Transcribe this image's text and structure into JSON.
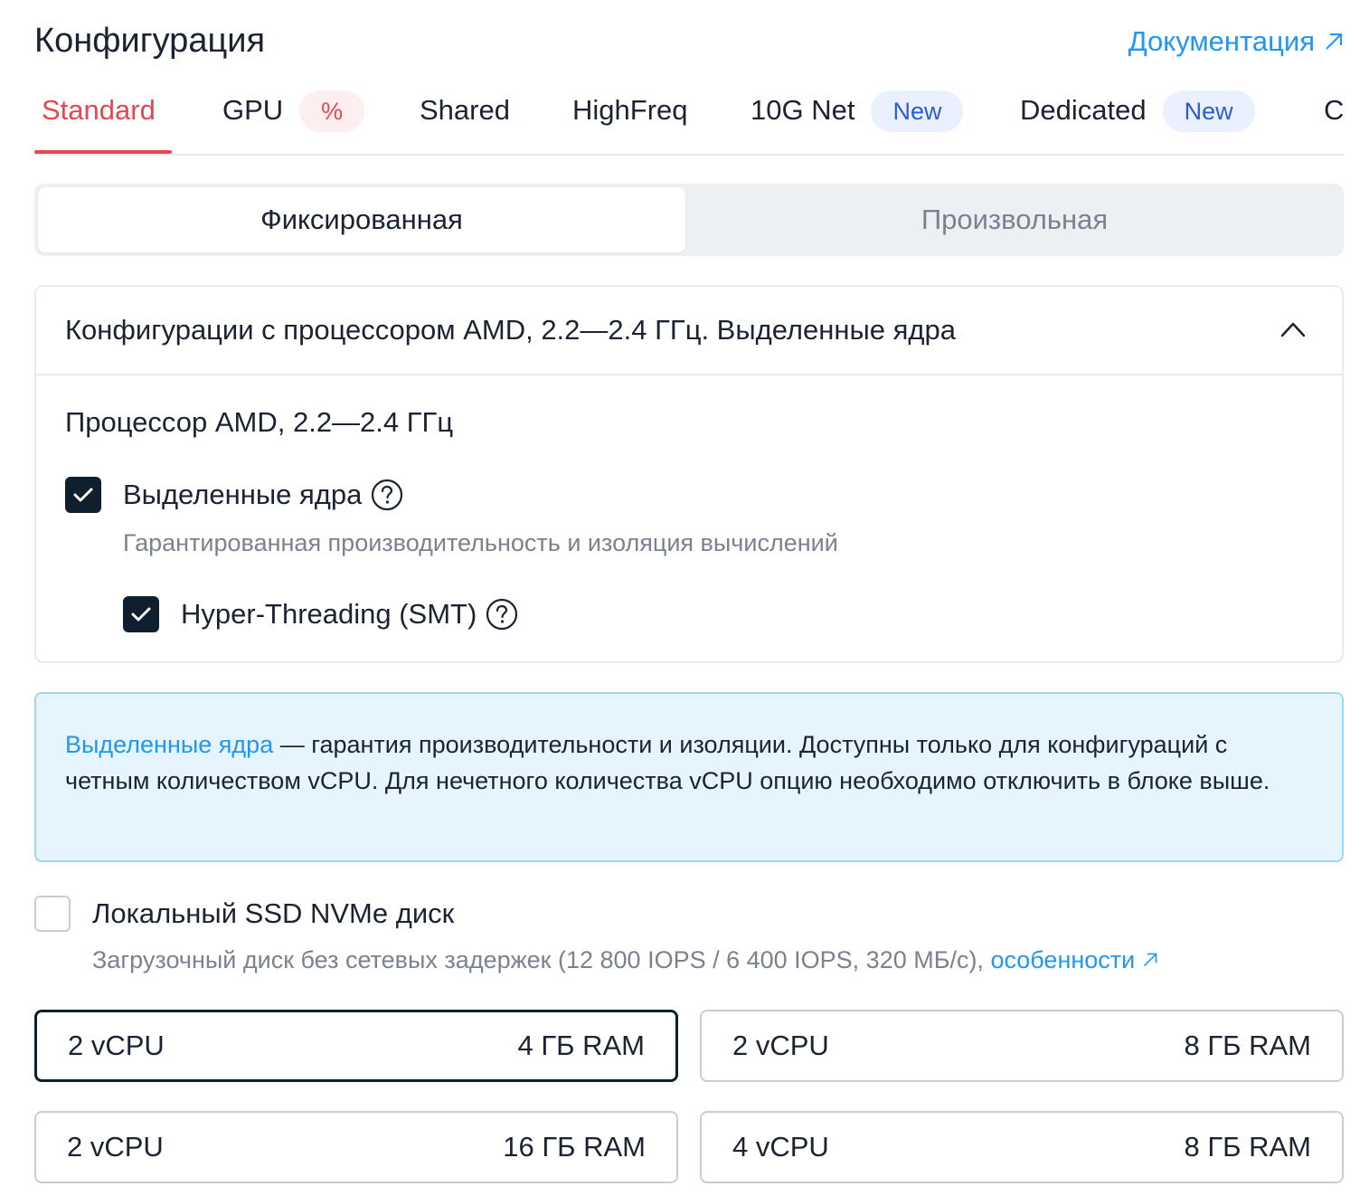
{
  "header": {
    "title": "Конфигурация",
    "doc_link": "Документация"
  },
  "tabs": [
    {
      "label": "Standard"
    },
    {
      "label": "GPU",
      "badge": "%"
    },
    {
      "label": "Shared"
    },
    {
      "label": "HighFreq"
    },
    {
      "label": "10G Net",
      "badge": "New"
    },
    {
      "label": "Dedicated",
      "badge": "New"
    },
    {
      "label": "C"
    }
  ],
  "mode": {
    "fixed": "Фиксированная",
    "custom": "Произвольная"
  },
  "accordion": {
    "title": "Конфигурации с процессором AMD, 2.2—2.4 ГГц. Выделенные ядра",
    "processor": "Процессор AMD, 2.2—2.4 ГГц",
    "dedicated_label": "Выделенные ядра",
    "dedicated_desc": "Гарантированная производительность и изоляция вычислений",
    "ht_label": "Hyper-Threading (SMT)"
  },
  "info": {
    "link": "Выделенные ядра",
    "text": " — гарантия производительности и изоляции. Доступны только для конфигураций с четным количеством vCPU. Для нечетного количества vCPU опцию необходимо отключить в блоке выше."
  },
  "ssd": {
    "label": "Локальный SSD NVMe диск",
    "desc": "Загрузочный диск без сетевых задержек (12 800 IOPS / 6 400 IOPS, 320 МБ/с), ",
    "link": "особенности"
  },
  "configs": [
    {
      "cpu": "2 vCPU",
      "ram": "4 ГБ RAM",
      "selected": true
    },
    {
      "cpu": "2 vCPU",
      "ram": "8 ГБ RAM",
      "selected": false
    },
    {
      "cpu": "2 vCPU",
      "ram": "16 ГБ RAM",
      "selected": false
    },
    {
      "cpu": "4 vCPU",
      "ram": "8 ГБ RAM",
      "selected": false
    }
  ],
  "colors": {
    "accent_red": "#e5474f",
    "link_blue": "#2196f3",
    "badge_blue": "#2b5bd7",
    "checkbox_dark": "#0f1f2e",
    "info_bg": "#e6f5fd"
  }
}
